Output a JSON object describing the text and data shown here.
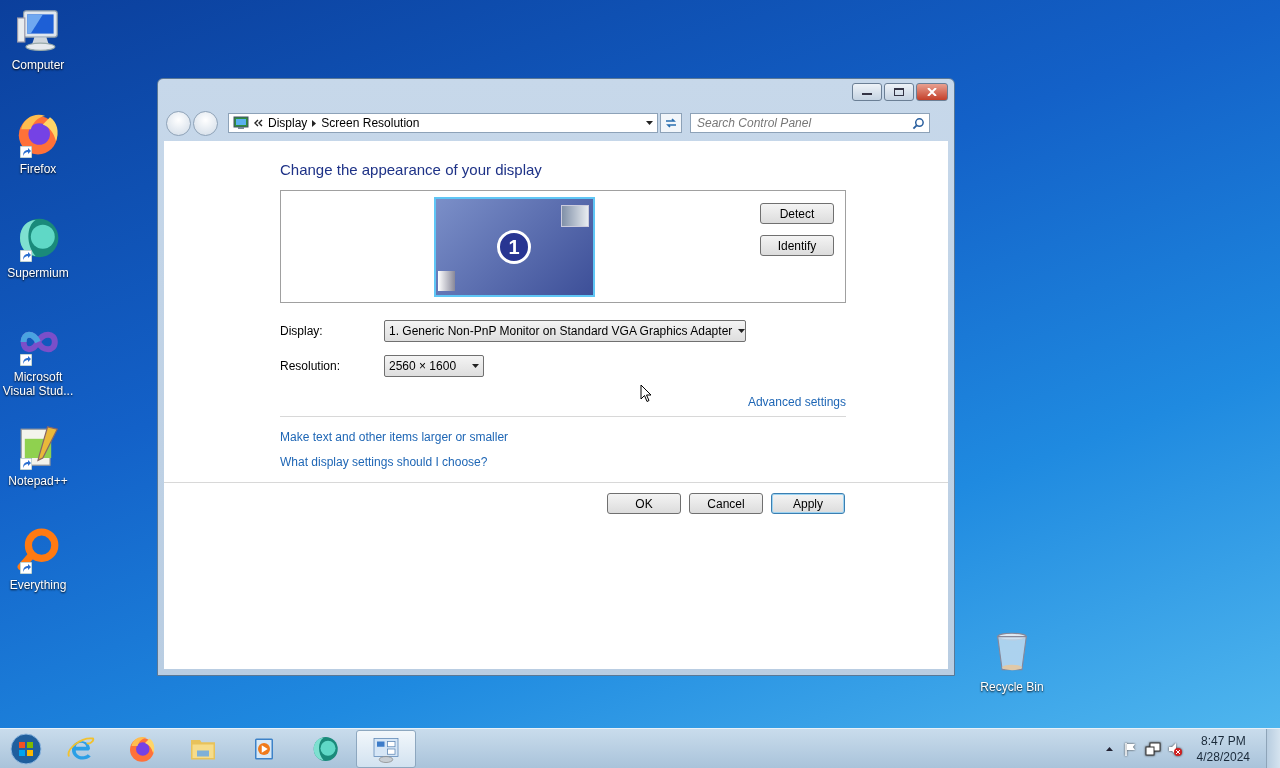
{
  "desktop_icons": [
    {
      "kind": "computer",
      "label": "Computer",
      "shortcut": false
    },
    {
      "kind": "firefox",
      "label": "Firefox",
      "shortcut": true
    },
    {
      "kind": "supermium",
      "label": "Supermium",
      "shortcut": true
    },
    {
      "kind": "vstudio",
      "label": "Microsoft Visual Stud...",
      "shortcut": true
    },
    {
      "kind": "notepad",
      "label": "Notepad++",
      "shortcut": true
    },
    {
      "kind": "everything",
      "label": "Everything",
      "shortcut": true
    }
  ],
  "recycle_bin": {
    "label": "Recycle Bin"
  },
  "window": {
    "address": {
      "crumbs": [
        "Display",
        "Screen Resolution"
      ]
    },
    "search": {
      "placeholder": "Search Control Panel"
    },
    "heading": "Change the appearance of your display",
    "monitor": {
      "number": "1",
      "selected": true
    },
    "side_buttons": [
      "Detect",
      "Identify"
    ],
    "fields": [
      {
        "label": "Display:",
        "value": "1. Generic Non-PnP Monitor on Standard VGA Graphics Adapter",
        "wide": true
      },
      {
        "label": "Resolution:",
        "value": "2560 × 1600",
        "wide": false
      }
    ],
    "advanced_link": "Advanced settings",
    "links": [
      "Make text and other items larger or smaller",
      "What display settings should I choose?"
    ],
    "buttons": [
      {
        "label": "OK",
        "default": false
      },
      {
        "label": "Cancel",
        "default": false
      },
      {
        "label": "Apply",
        "default": true
      }
    ]
  },
  "taskbar": {
    "apps": [
      {
        "kind": "ie",
        "active": false
      },
      {
        "kind": "firefox",
        "active": false
      },
      {
        "kind": "explorer",
        "active": false
      },
      {
        "kind": "media",
        "active": false
      },
      {
        "kind": "supermium",
        "active": false
      },
      {
        "kind": "controlpanel",
        "active": true
      }
    ],
    "tray": {
      "time": "8:47 PM",
      "date": "4/28/2024"
    }
  }
}
